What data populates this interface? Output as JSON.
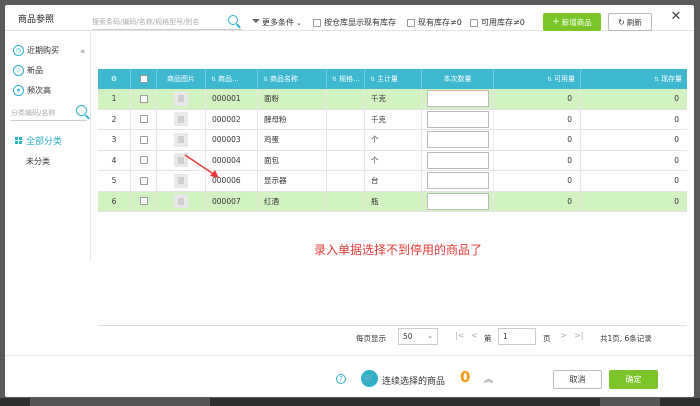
{
  "dialog": {
    "title": "商品参照"
  },
  "sidebar": {
    "quick": [
      {
        "label": "近期购买"
      },
      {
        "label": "新品"
      },
      {
        "label": "频次高"
      }
    ],
    "search_placeholder": "分类编码/名称",
    "categories": [
      {
        "label": "全部分类",
        "active": true
      },
      {
        "label": "未分类",
        "active": false
      }
    ]
  },
  "toolbar": {
    "search_placeholder": "搜索条码/编码/名称/规格型号/别名",
    "more_conditions": "更多条件",
    "filters": [
      {
        "label": "按仓库显示现有库存"
      },
      {
        "label": "现有库存≠0"
      },
      {
        "label": "可用库存≠0"
      }
    ],
    "new_product": "新增商品",
    "refresh": "刷新"
  },
  "table": {
    "columns": [
      "",
      "",
      "商品图片",
      "商品...",
      "商品名称",
      "规格...",
      "主计量",
      "本次数量",
      "可用量",
      "现存量"
    ],
    "rows": [
      {
        "index": "1",
        "code": "000001",
        "name": "面粉",
        "unit": "千克",
        "available": "0",
        "stock": "0",
        "highlight": true
      },
      {
        "index": "2",
        "code": "000002",
        "name": "酵母粉",
        "unit": "千克",
        "available": "0",
        "stock": "0",
        "highlight": false
      },
      {
        "index": "3",
        "code": "000003",
        "name": "鸡蛋",
        "unit": "个",
        "available": "0",
        "stock": "0",
        "highlight": false
      },
      {
        "index": "4",
        "code": "000004",
        "name": "面包",
        "unit": "个",
        "available": "0",
        "stock": "0",
        "highlight": false
      },
      {
        "index": "5",
        "code": "000006",
        "name": "显示器",
        "unit": "台",
        "available": "0",
        "stock": "0",
        "highlight": false
      },
      {
        "index": "6",
        "code": "000007",
        "name": "红酒",
        "unit": "瓶",
        "available": "0",
        "stock": "0",
        "highlight": true
      }
    ]
  },
  "annotation": {
    "text": "录入单据选择不到停用的商品了",
    "color": "#e53935"
  },
  "pager": {
    "per_page_label": "每页显示",
    "per_page_value": "50",
    "page_prefix": "第",
    "page_value": "1",
    "page_suffix": "页",
    "summary": "共1页, 6条记录"
  },
  "footer": {
    "continuous_label": "连续选择的商品",
    "selected_count": "0",
    "cancel": "取消",
    "confirm": "确定"
  },
  "colors": {
    "accent": "#3db8ce",
    "primary_button": "#7bc529",
    "row_highlight": "#d3f2c1",
    "count": "#f39c12"
  }
}
